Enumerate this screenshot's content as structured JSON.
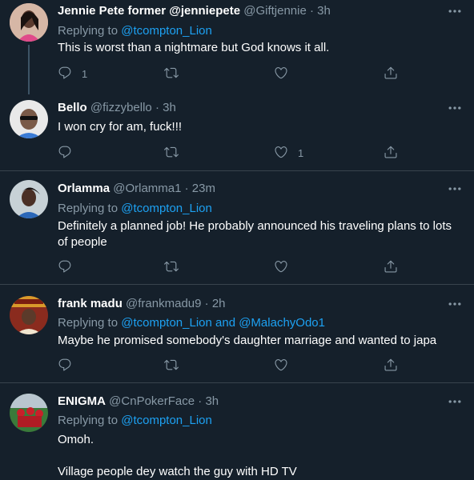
{
  "tweets": [
    {
      "name": "Jennie Pete former @jenniepete",
      "handle": "@Giftjennie",
      "time": "· 3h",
      "replying_prefix": "Replying to ",
      "replying_to": "@tcompton_Lion",
      "body": "This is worst than a nightmare but God knows it all.",
      "reply_count": "1",
      "retweet_count": "",
      "like_count": ""
    },
    {
      "name": "Bello",
      "handle": "@fizzybello",
      "time": "· 3h",
      "body": "I won cry for am, fuck!!!",
      "reply_count": "",
      "retweet_count": "",
      "like_count": "1"
    },
    {
      "name": "Orlamma",
      "handle": "@Orlamma1",
      "time": "· 23m",
      "replying_prefix": "Replying to ",
      "replying_to": "@tcompton_Lion",
      "body": "Definitely a planned job! He probably announced his traveling plans to lots of people",
      "reply_count": "",
      "retweet_count": "",
      "like_count": ""
    },
    {
      "name": "frank madu",
      "handle": "@frankmadu9",
      "time": "· 2h",
      "replying_prefix": "Replying to ",
      "replying_to": "@tcompton_Lion and @MalachyOdo1",
      "body": "Maybe he promised somebody's daughter marriage and wanted to japa",
      "reply_count": "",
      "retweet_count": "",
      "like_count": ""
    },
    {
      "name": "ENIGMA",
      "handle": "@CnPokerFace",
      "time": "· 3h",
      "replying_prefix": "Replying to ",
      "replying_to": "@tcompton_Lion",
      "body_line1": "Omoh.",
      "body_line2": "Village people dey watch the guy with HD TV"
    }
  ],
  "icons": [
    "more-icon",
    "reply-icon",
    "retweet-icon",
    "like-icon",
    "share-icon"
  ],
  "colors": {
    "background": "#15202b",
    "link": "#1da1f2",
    "muted": "#8899a6",
    "separator": "#38444d"
  }
}
